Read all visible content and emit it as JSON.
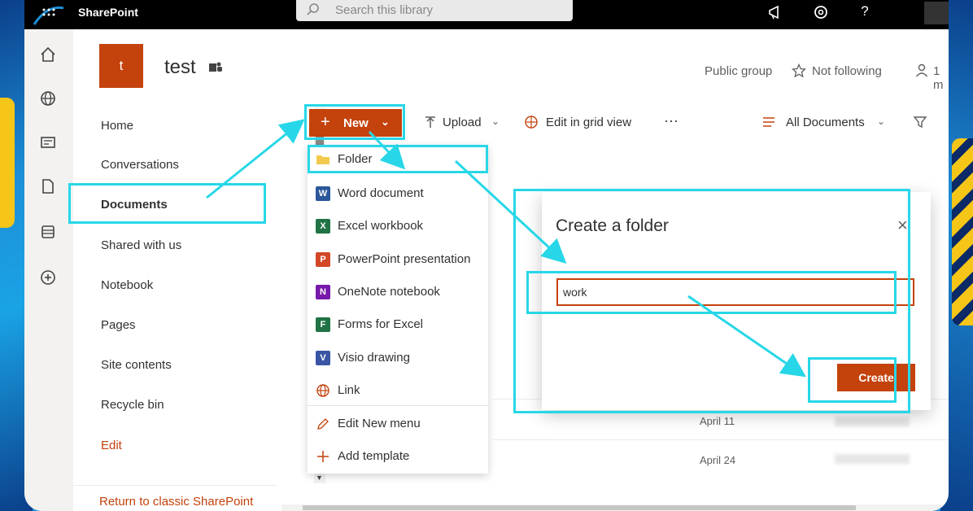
{
  "app": {
    "name": "SharePoint"
  },
  "search": {
    "placeholder": "Search this library"
  },
  "suite_icons": [
    "megaphone-icon",
    "settings-icon",
    "help-icon"
  ],
  "left_rail_icons": [
    "home-icon",
    "globe-icon",
    "news-icon",
    "file-icon",
    "list-icon",
    "add-icon"
  ],
  "site": {
    "logo_letter": "t",
    "title": "test",
    "privacy": "Public group",
    "follow": "Not following",
    "members": "1 m"
  },
  "quick_launch": {
    "items": [
      {
        "label": "Home"
      },
      {
        "label": "Conversations"
      },
      {
        "label": "Documents",
        "active": true
      },
      {
        "label": "Shared with us"
      },
      {
        "label": "Notebook"
      },
      {
        "label": "Pages"
      },
      {
        "label": "Site contents"
      },
      {
        "label": "Recycle bin"
      },
      {
        "label": "Edit"
      }
    ],
    "return_link": "Return to classic SharePoint"
  },
  "command_bar": {
    "new": "New",
    "upload": "Upload",
    "edit_grid": "Edit in grid view",
    "more": "···",
    "view": "All Documents"
  },
  "new_menu": {
    "items": [
      {
        "label": "Folder",
        "icon": "folder-icon",
        "color": "#f2c94c"
      },
      {
        "label": "Word document",
        "icon": "word-icon",
        "color": "#2b579a",
        "letter": "W"
      },
      {
        "label": "Excel workbook",
        "icon": "excel-icon",
        "color": "#217346",
        "letter": "X"
      },
      {
        "label": "PowerPoint presentation",
        "icon": "powerpoint-icon",
        "color": "#d24726",
        "letter": "P"
      },
      {
        "label": "OneNote notebook",
        "icon": "onenote-icon",
        "color": "#7719aa",
        "letter": "N"
      },
      {
        "label": "Forms for Excel",
        "icon": "forms-icon",
        "color": "#217346",
        "letter": "F"
      },
      {
        "label": "Visio drawing",
        "icon": "visio-icon",
        "color": "#3955a3",
        "letter": "V"
      },
      {
        "label": "Link",
        "icon": "link-icon",
        "color": "#c4420c"
      },
      {
        "label": "Edit New menu",
        "icon": "edit-icon",
        "color": "#c4420c"
      },
      {
        "label": "Add template",
        "icon": "add-icon",
        "color": "#c4420c"
      }
    ]
  },
  "list_rows": [
    {
      "date": "April 11"
    },
    {
      "date": "April 24"
    }
  ],
  "dialog": {
    "title": "Create a folder",
    "close": "×",
    "input_value": "work",
    "create_label": "Create"
  },
  "colors": {
    "accent": "#c4420c",
    "highlight": "#27d7e8",
    "suitebar": "#000000"
  }
}
